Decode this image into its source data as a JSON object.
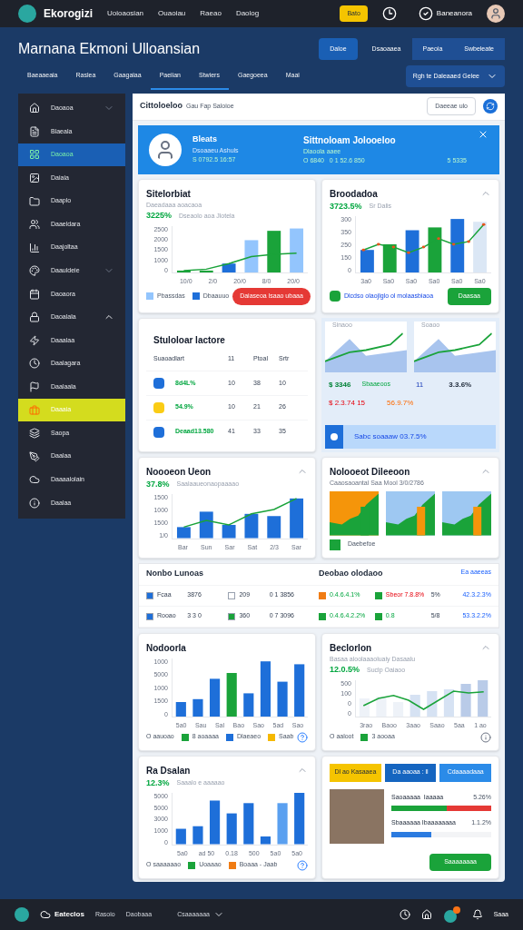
{
  "topbar": {
    "brand": "Ekorogizi",
    "nav": [
      "Uoioaosian",
      "Ouaoiau",
      "Raeao",
      "Daolog"
    ],
    "badge": "Bato",
    "user": "Baneanora"
  },
  "header": {
    "title": "Marnana Ekmoni Ulloansian",
    "buttons": [
      {
        "label": "Daloe",
        "selected": true
      },
      {
        "label": "Dsaoaaea",
        "selected": false
      },
      {
        "label": "Paeoia",
        "selected": false
      },
      {
        "label": "Swbeleate",
        "selected": false
      }
    ],
    "tabs": [
      {
        "label": "Baeaaeaia",
        "selected": false
      },
      {
        "label": "Raslea",
        "selected": false
      },
      {
        "label": "Gaagaiaa",
        "selected": false
      },
      {
        "label": "Paeiian",
        "selected": true
      },
      {
        "label": "Stwiers",
        "selected": true
      },
      {
        "label": "Gaegoeea",
        "selected": false
      },
      {
        "label": "Maai",
        "selected": false
      }
    ],
    "dropdown": "Rgh te Daleaaed Gelee"
  },
  "sidebar": [
    {
      "label": "Daoaoa",
      "selected": false,
      "highlighted": false,
      "expanded": false
    },
    {
      "label": "Blaeala",
      "selected": false,
      "highlighted": false
    },
    {
      "label": "Daoaoa",
      "selected": true,
      "highlighted": false
    },
    {
      "label": "Daiaia",
      "selected": false,
      "highlighted": false
    },
    {
      "label": "Daaplo",
      "selected": false,
      "highlighted": false
    },
    {
      "label": "Daaeldara",
      "selected": false,
      "highlighted": false
    },
    {
      "label": "Daajoltaa",
      "selected": false,
      "highlighted": false
    },
    {
      "label": "Daauldeie",
      "selected": false,
      "highlighted": false,
      "expanded": false
    },
    {
      "label": "Daoaora",
      "selected": false,
      "highlighted": false
    },
    {
      "label": "Daoalala",
      "selected": false,
      "highlighted": false,
      "expanded": true
    },
    {
      "label": "Daaalaa",
      "selected": false,
      "highlighted": false
    },
    {
      "label": "Daalagara",
      "selected": false,
      "highlighted": false
    },
    {
      "label": "Daalaala",
      "selected": false,
      "highlighted": false
    },
    {
      "label": "Daaaia",
      "selected": false,
      "highlighted": true
    },
    {
      "label": "Saopa",
      "selected": false,
      "highlighted": false
    },
    {
      "label": "Daalaa",
      "selected": false,
      "highlighted": false
    },
    {
      "label": "Daaaalolain",
      "selected": false,
      "highlighted": false
    },
    {
      "label": "Daalaa",
      "selected": false,
      "highlighted": false
    }
  ],
  "panel": {
    "title": "Cittoloeloo",
    "subtitle": "Gau Fap Saloioe",
    "button": "Daeeae ulo"
  },
  "banner": {
    "name": "Bleats",
    "line1": "Dsoaaeu Ashuls",
    "line2": "S 0792.5 16:57",
    "title": "Sittnoloam Jolooeloo",
    "line3": "Dlaoola aaee",
    "line4": "O 6840   0 1 52.6 850",
    "value": "5 5335"
  },
  "cards": [
    {
      "title": "Sitelorbiat",
      "sub": "Daeadaaa aoacaoa",
      "pct": "3225%",
      "note": "Dseaolo aoa Jlotela",
      "yticks": [
        "2500",
        "2000",
        "1500",
        "1000",
        "0"
      ],
      "xticks": [
        "10/0",
        "2/0",
        "20/0",
        "8/0",
        "20/0"
      ],
      "legend": [
        {
          "text": "Pbassdas",
          "color": "#93c5fd"
        },
        {
          "text": "Dbaauuo",
          "color": "#1e6fd9"
        }
      ],
      "button": "Daiaseoa lsaao ubaaa"
    },
    {
      "title": "Broodadoa",
      "pct": "3723.5%",
      "note": "Sr Dalis",
      "yticks": [
        "300",
        "350",
        "250",
        "150",
        "0"
      ],
      "xticks": [
        "3a0",
        "Sa0",
        "Sa0",
        "Sa0",
        "Sa0",
        "Sa0"
      ],
      "footnote": "Dlcdso olaojlglo ol molaasbiaoa",
      "button": "Daasaa"
    }
  ],
  "table": {
    "title": "Stuloloar lactore",
    "columns": [
      "Suaoadlart",
      "11",
      "Ptoal",
      "Srtr"
    ],
    "rows": [
      {
        "color": "#1e6fd9",
        "cells": [
          "8d4L%",
          "10",
          "38",
          "10"
        ]
      },
      {
        "color": "#facc15",
        "cells": [
          "54.9%",
          "10",
          "21",
          "26"
        ]
      },
      {
        "color": "#1e6fd9",
        "cells": [
          "Deaad13.580",
          "41",
          "33",
          "35"
        ]
      }
    ]
  },
  "summary": {
    "charts": [
      "Sinaoo",
      "Soaoo"
    ],
    "stat1": "$ 3346",
    "stat1_label": "Sbaaeoos",
    "stat2": "11",
    "stat3": "3.3.6%",
    "stat4": "$ 2.3.74 15",
    "stat5": "56.9.7%",
    "strip": "Sabc soaaaw 03.7.5%"
  },
  "card3": {
    "title": "Noooeon Ueon",
    "pct": "37.8%",
    "note": "Saalaaueonaopaaaao",
    "yticks": [
      "1500",
      "1000",
      "1500",
      "1/0"
    ],
    "xticks": [
      "Bar",
      "Sun",
      "Sar",
      "Sat",
      "2/3",
      "Sar"
    ]
  },
  "card4": {
    "title": "Nolooeot Dileeoon",
    "note": "Caaosaoantal Saa Mool 3/0/2786",
    "legend": "Daebefoe"
  },
  "table2": {
    "left_title": "Nonbo Lunoas",
    "right_title": "Deobao olodaoo",
    "link": "Ea aaeeas",
    "rows": [
      {
        "left": [
          {
            "text": "Fcaa",
            "color": "#1e6fd9"
          },
          {
            "text": "3876"
          },
          {
            "text": "209",
            "color": "#ffffff"
          },
          {
            "text": "0 1 3856"
          }
        ],
        "right": [
          {
            "text": "0.4.6.4.1%",
            "color": "#f07c14",
            "kind": "gain"
          },
          {
            "text": "Sbeor 7.8.8%",
            "color": "#1aa33a",
            "kind": "loss"
          },
          {
            "text": "5%",
            "kind": "plain"
          },
          {
            "text": "42.3.2.3%",
            "kind": "total"
          }
        ]
      },
      {
        "left": [
          {
            "text": "Rooao",
            "color": "#1e6fd9"
          },
          {
            "text": "3 3 0"
          },
          {
            "text": "360",
            "color": "#1aa33a"
          },
          {
            "text": "0 7 3096"
          }
        ],
        "right": [
          {
            "text": "0.4.6.4.2.2%",
            "color": "#1aa33a",
            "kind": "gain"
          },
          {
            "text": "0.8",
            "color": "#1aa33a",
            "kind": "gain"
          },
          {
            "text": "5/8",
            "kind": "plain"
          },
          {
            "text": "53.3.2.2%",
            "kind": "total"
          }
        ]
      }
    ]
  },
  "card5": {
    "title": "Nodoorla",
    "yticks": [
      "1000",
      "5000",
      "1000",
      "1500",
      "0"
    ],
    "xticks": [
      "5a0",
      "Sau",
      "Sal",
      "Bao",
      "Sao",
      "5ad",
      "Sao"
    ],
    "legend": [
      {
        "text": "O aauoao"
      },
      {
        "text": "8 aoaaaa",
        "color": "#1aa33a"
      },
      {
        "text": "Dlaeaeo",
        "color": "#1e6fd9"
      },
      {
        "text": "Saab",
        "color": "#f5b800"
      }
    ]
  },
  "card6": {
    "title": "Beclorlon",
    "sub": "Basaa aloolaaaoluaiy Dasaalu",
    "pct": "12.0.5%",
    "note": "Suclp Oaiaoo",
    "yticks": [
      "500",
      "100",
      "0",
      "0"
    ],
    "xticks": [
      "3rao",
      "Baoo",
      "3aao",
      "Saao",
      "5aa",
      "1 ao"
    ],
    "legend": [
      {
        "text": "O aaloot"
      },
      {
        "text": "3 aooaa",
        "color": "#1aa33a"
      }
    ]
  },
  "card7": {
    "title": "Ra Dsalan",
    "pct": "12.3%",
    "note": "Saaalo e aaaaao",
    "yticks": [
      "5000",
      "5000",
      "3000",
      "1000",
      "0"
    ],
    "xticks": [
      "5a0",
      "ad 50",
      "0.18",
      "500",
      "5a0",
      "5a0"
    ],
    "legend": [
      {
        "text": "O saaaaaao"
      },
      {
        "text": "Uoaaao",
        "color": "#1aa33a"
      },
      {
        "text": "Boaaa - Jaab",
        "color": "#f07c14"
      }
    ]
  },
  "actions": {
    "tabs": [
      {
        "label": "Dl ao Kasaaea",
        "kind": "warning"
      },
      {
        "label": "Da aaoaa : ll",
        "kind": "primary"
      },
      {
        "label": "Cdaaaadaaa",
        "kind": "secondary"
      }
    ],
    "progress": [
      {
        "label": "Saoaaaaa  Iaaaaa",
        "value": "5.26%",
        "level": 0.55
      },
      {
        "label": "Sbaaaaaa Ibaaaaaaaa",
        "value": "1.1.2%",
        "level": 0.4
      }
    ],
    "button": "Saaaaaaaa"
  },
  "footer": {
    "brand": "Eateclos",
    "links": [
      "Rasoio",
      "Daobaaa"
    ],
    "menu": "Csaaaaaaa",
    "user": "Saaa"
  }
}
